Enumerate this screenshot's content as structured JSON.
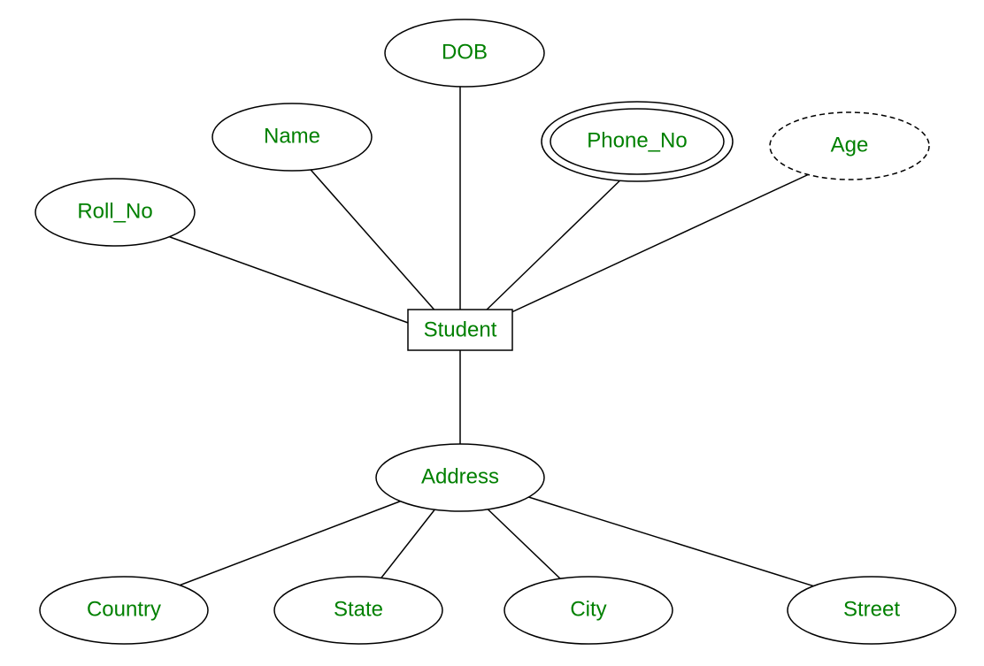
{
  "diagram": {
    "type": "ER",
    "entity": {
      "label": "Student"
    },
    "attributes": {
      "roll_no": {
        "label": "Roll_No",
        "style": "simple"
      },
      "name": {
        "label": "Name",
        "style": "simple"
      },
      "dob": {
        "label": "DOB",
        "style": "simple"
      },
      "phone_no": {
        "label": "Phone_No",
        "style": "multivalued"
      },
      "age": {
        "label": "Age",
        "style": "derived"
      },
      "address": {
        "label": "Address",
        "style": "composite",
        "components": {
          "country": {
            "label": "Country"
          },
          "state": {
            "label": "State"
          },
          "city": {
            "label": "City"
          },
          "street": {
            "label": "Street"
          }
        }
      }
    }
  }
}
